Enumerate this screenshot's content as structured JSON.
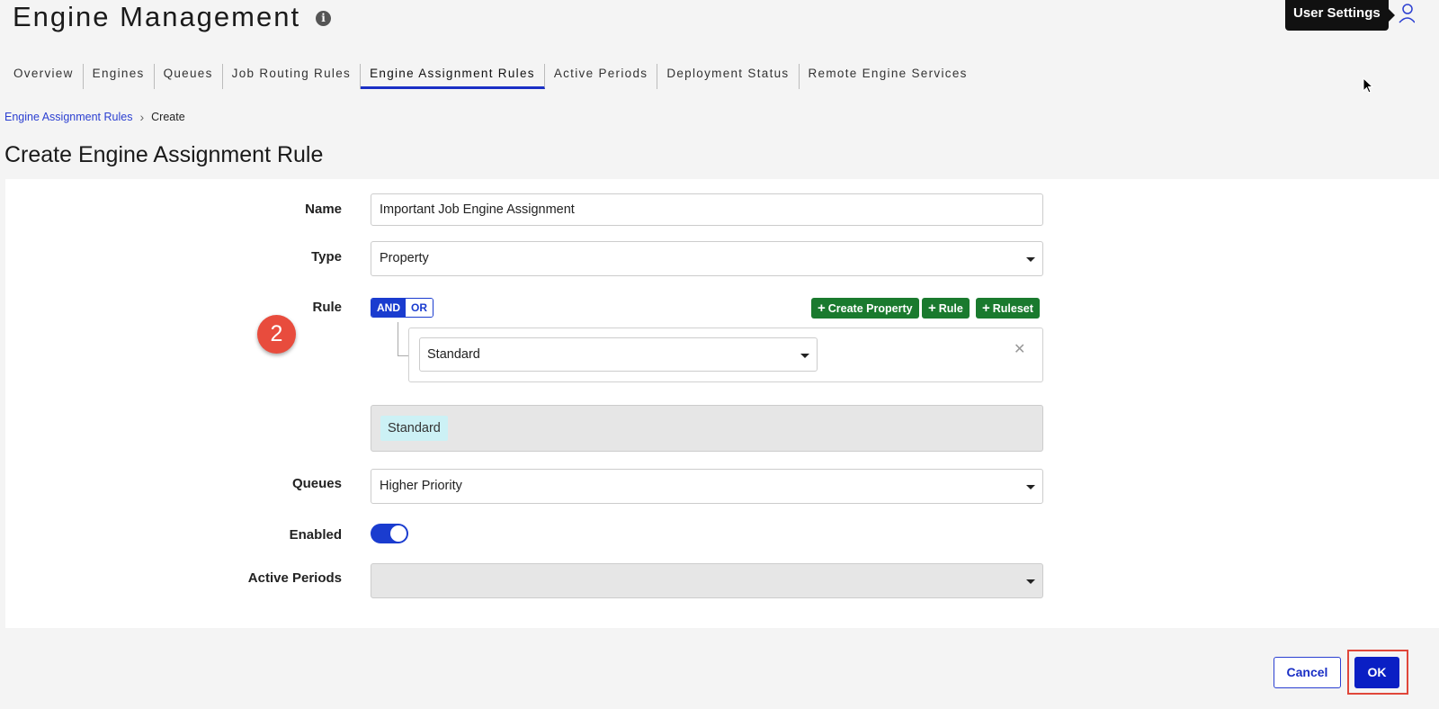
{
  "header": {
    "title": "Engine Management",
    "tooltip": "User Settings"
  },
  "tabs": [
    {
      "label": "Overview"
    },
    {
      "label": "Engines"
    },
    {
      "label": "Queues"
    },
    {
      "label": "Job Routing Rules"
    },
    {
      "label": "Engine Assignment Rules",
      "active": true
    },
    {
      "label": "Active Periods"
    },
    {
      "label": "Deployment Status"
    },
    {
      "label": "Remote Engine Services"
    }
  ],
  "breadcrumb": {
    "parent": "Engine Assignment Rules",
    "current": "Create"
  },
  "page_title": "Create Engine Assignment Rule",
  "form": {
    "name_label": "Name",
    "name_value": "Important Job Engine Assignment",
    "type_label": "Type",
    "type_value": "Property",
    "rule_label": "Rule",
    "and_label": "AND",
    "or_label": "OR",
    "create_property_label": "Create Property",
    "rule_button_label": "Rule",
    "ruleset_button_label": "Ruleset",
    "rule_select_value": "Standard",
    "rule_close": "✕",
    "preview_chip": "Standard",
    "queues_label": "Queues",
    "queues_value": "Higher Priority",
    "enabled_label": "Enabled",
    "enabled": true,
    "active_periods_label": "Active Periods",
    "active_periods_value": ""
  },
  "step_badge": "2",
  "footer": {
    "cancel_label": "Cancel",
    "ok_label": "OK"
  },
  "colors": {
    "accent": "#1a3ccf",
    "green": "#1a7a2e",
    "badge": "#e84c3d"
  }
}
